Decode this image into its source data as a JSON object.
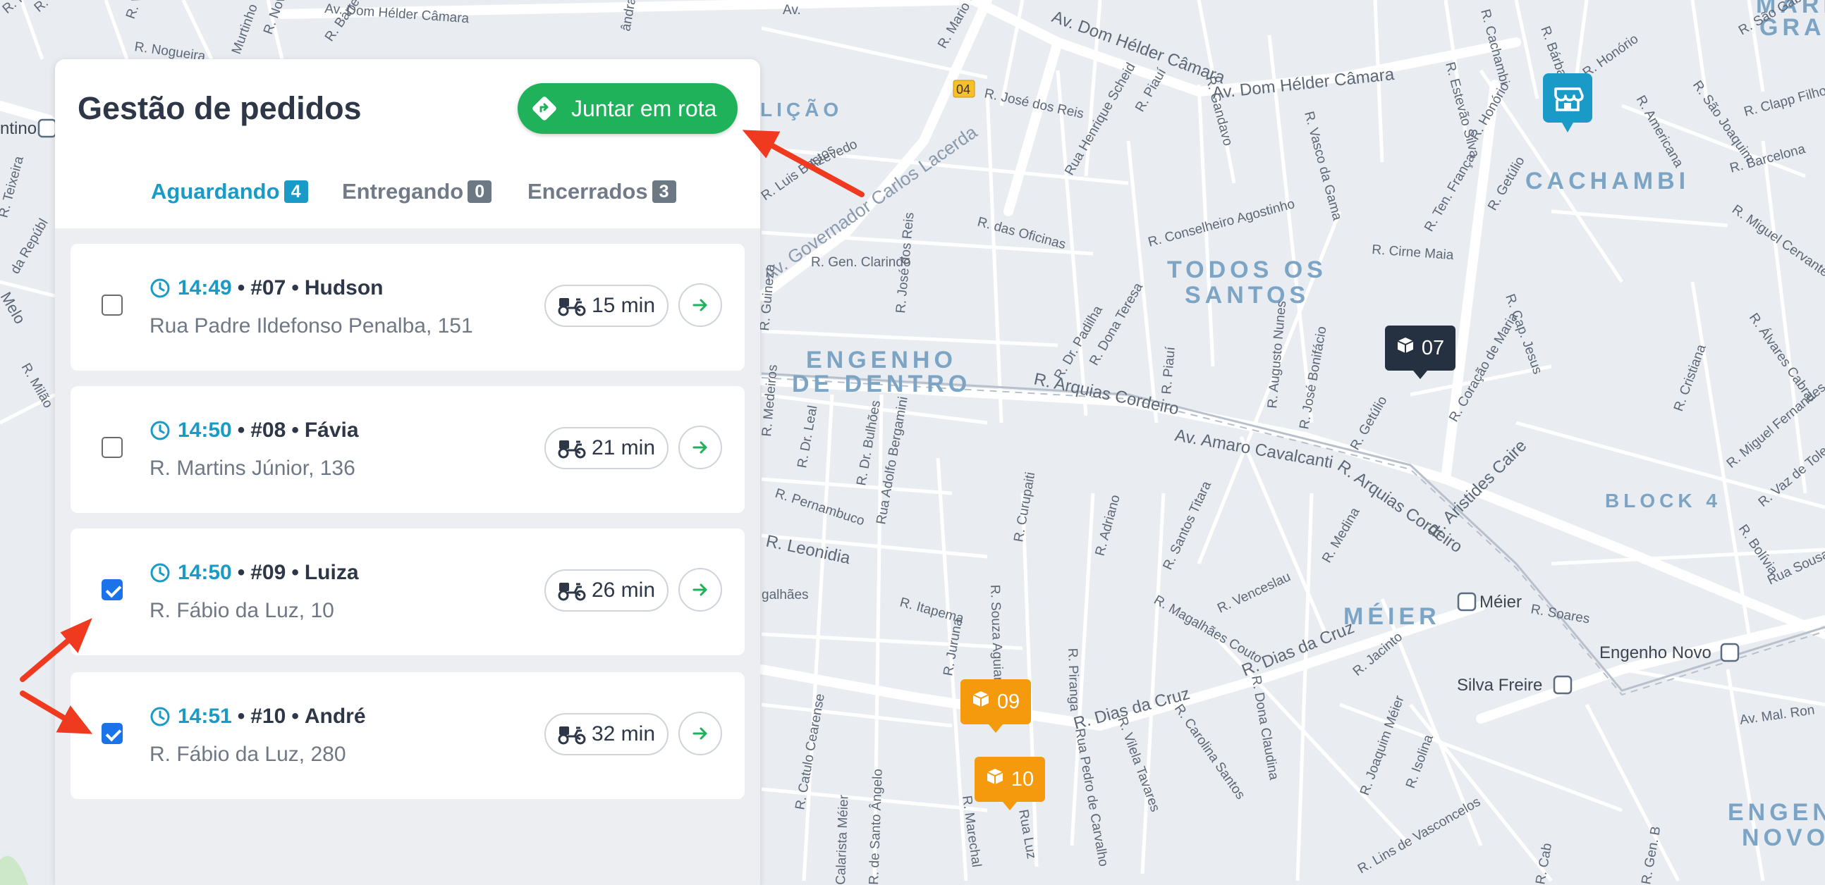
{
  "panel": {
    "title": "Gestão de pedidos",
    "join_button": "Juntar em rota",
    "tabs": [
      {
        "label": "Aguardando",
        "count": "4",
        "active": true
      },
      {
        "label": "Entregando",
        "count": "0",
        "active": false
      },
      {
        "label": "Encerrados",
        "count": "3",
        "active": false
      }
    ],
    "orders": [
      {
        "checked": false,
        "time": "14:49",
        "order": "#07",
        "name": "Hudson",
        "address": "Rua Padre Ildefonso Penalba, 151",
        "eta": "15 min"
      },
      {
        "checked": false,
        "time": "14:50",
        "order": "#08",
        "name": "Fávia",
        "address": "R. Martins Júnior, 136",
        "eta": "21 min"
      },
      {
        "checked": true,
        "time": "14:50",
        "order": "#09",
        "name": "Luiza",
        "address": "R. Fábio da Luz, 10",
        "eta": "26 min"
      },
      {
        "checked": true,
        "time": "14:51",
        "order": "#10",
        "name": "André",
        "address": "R. Fábio da Luz, 280",
        "eta": "32 min"
      }
    ],
    "separator": "•"
  },
  "map": {
    "pins": [
      {
        "label": "07",
        "color": "#253140"
      },
      {
        "label": "09",
        "color": "#f59a0c"
      },
      {
        "label": "10",
        "color": "#f59a0c"
      }
    ],
    "store_pin_color": "#1a9bc7",
    "districts": [
      "CACHAMBI",
      "TODOS OS",
      "SANTOS",
      "ENGENHO",
      "DE DENTRO",
      "MÉIER",
      "BLOCK 4",
      "MARIA",
      "GRAÇ",
      "ENGEN",
      "NOVO",
      "LIÇÃO"
    ],
    "streets": [
      "Av. Dom Hélder Câmara",
      "Av. Dom Hélder Câmara",
      "Av. Dom Hélder Câmara",
      "R. Nogueira",
      "R. Cup",
      "R. Vit",
      "Murtinho",
      "R. Nova",
      "R. Barreto",
      "ândrade",
      "Av.",
      "R. Mario Ca",
      "R. José dos Reis",
      "Rua Henrique Scheid",
      "R. Piauí",
      "R. Gandavo",
      "R. Vasco da Gama",
      "R. Estevão Silva",
      "R. Cachambi",
      "R. Honório",
      "R. Honório",
      "R. São Gabriel",
      "R. Bárbara",
      "R. São Joaquim",
      "R. Americana",
      "R. Clapp Filho",
      "R. Barcelona",
      "R. Miguel Cervantes",
      "R. Álvares Cabral",
      "R. Cristiana",
      "R. Miguel Fernandes",
      "R. Vaz de Toledo",
      "R. Bolívia",
      "Rua Sousa",
      "R. Getúlio",
      "R. Ten. França",
      "R. Cirne Maia",
      "R. Cap. Jesus",
      "R. Coração de Maria",
      "R. Conselheiro Agostinho",
      "R. das Oficinas",
      "R. Gen. Clarindo",
      "R. José dos Reis",
      "Av. Governador Carlos Lacerda",
      "R. Luis Bastos",
      "Azevedo",
      "R. Dr. Padilha",
      "R. Dona Teresa",
      "R. Piauí",
      "R. Augusto Nunes",
      "R. José Bonifácio",
      "R. Arquias Cordeiro",
      "Av. Amaro Cavalcanti",
      "R. Arquias Cordeiro",
      "R. Aristides Caire",
      "R. Getúlio",
      "R. Dr. Leal",
      "R. Dr. Bulhões",
      "Rua Adolfo Bergamini",
      "R. Pernambuco",
      "R. Leonidia",
      "galhães",
      "R. Guineza",
      "R. Medeiros",
      "R. Curupaiti",
      "R. Adriano",
      "R. Santos Titara",
      "R. Magalhães Couto",
      "R. Venceslau",
      "R. Medina",
      "R. Jacinto",
      "R. Soares",
      "R. Dias da Cruz",
      "R. Dias da Cruz",
      "R. Itapema",
      "R. Souza Aguiar",
      "R. Juruna",
      "R. Catulo Cearense",
      "R. Marechal",
      "R. de Santo Ângelo",
      "Calarista Méier",
      "R. Piranga",
      "Rua Pedro de Carvalho",
      "R. Vilela Tavares",
      "R. Carolina Santos",
      "R. Dona Claudina",
      "R. Joaquim Méier",
      "R. Isolina",
      "R. Lins de Vasconcelos",
      "R. Gen. B",
      "R. Cab",
      "Av. Mal. Ron",
      "R. Teixeira",
      "da Repúbl",
      "Melo",
      "R. Milão",
      "R. Pe",
      "Méier",
      "Engenho Novo",
      "Silva Freire",
      "ntino",
      "04",
      "Rua Luz"
    ]
  }
}
